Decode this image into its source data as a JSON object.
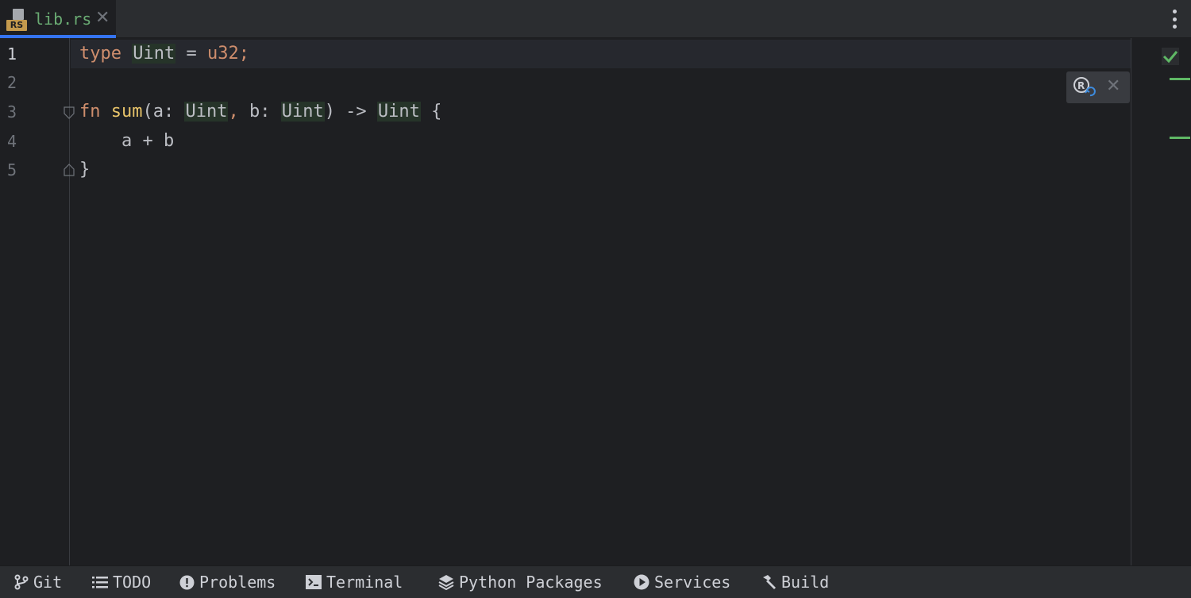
{
  "tab": {
    "file_icon_label": "RS",
    "file_name": "lib.rs",
    "close_glyph": "✕"
  },
  "editor": {
    "line_numbers": [
      "1",
      "2",
      "3",
      "4",
      "5"
    ],
    "lines": [
      [
        {
          "t": "type",
          "c": "kw"
        },
        {
          "t": " ",
          "c": "plain"
        },
        {
          "t": "Uint",
          "c": "ty"
        },
        {
          "t": " = ",
          "c": "plain"
        },
        {
          "t": "u32",
          "c": "kw"
        },
        {
          "t": ";",
          "c": "kw"
        }
      ],
      [],
      [
        {
          "t": "fn",
          "c": "kw"
        },
        {
          "t": " ",
          "c": "plain"
        },
        {
          "t": "sum",
          "c": "fn"
        },
        {
          "t": "(a: ",
          "c": "plain"
        },
        {
          "t": "Uint",
          "c": "ty"
        },
        {
          "t": ",",
          "c": "kw"
        },
        {
          "t": " b: ",
          "c": "plain"
        },
        {
          "t": "Uint",
          "c": "ty"
        },
        {
          "t": ") -> ",
          "c": "plain"
        },
        {
          "t": "Uint",
          "c": "ty"
        },
        {
          "t": " {",
          "c": "plain"
        }
      ],
      [
        {
          "t": "    a + b",
          "c": "plain"
        }
      ],
      [
        {
          "t": "}",
          "c": "plain"
        }
      ]
    ],
    "inspection_status_icon": "check-icon",
    "reload_popup_close": "✕"
  },
  "toolwindows": [
    {
      "label": "Git",
      "icon": "git-branch-icon"
    },
    {
      "label": "TODO",
      "icon": "list-icon"
    },
    {
      "label": "Problems",
      "icon": "problems-icon"
    },
    {
      "label": "Terminal",
      "icon": "terminal-icon"
    },
    {
      "label": "Python Packages",
      "icon": "packages-icon"
    },
    {
      "label": "Services",
      "icon": "services-icon"
    },
    {
      "label": "Build",
      "icon": "hammer-icon"
    }
  ],
  "colors": {
    "keyword": "#cf8e6d",
    "function": "#e8c46a",
    "text": "#bcbec4",
    "tab_underline": "#3574f0",
    "ok_green": "#5fb865"
  }
}
